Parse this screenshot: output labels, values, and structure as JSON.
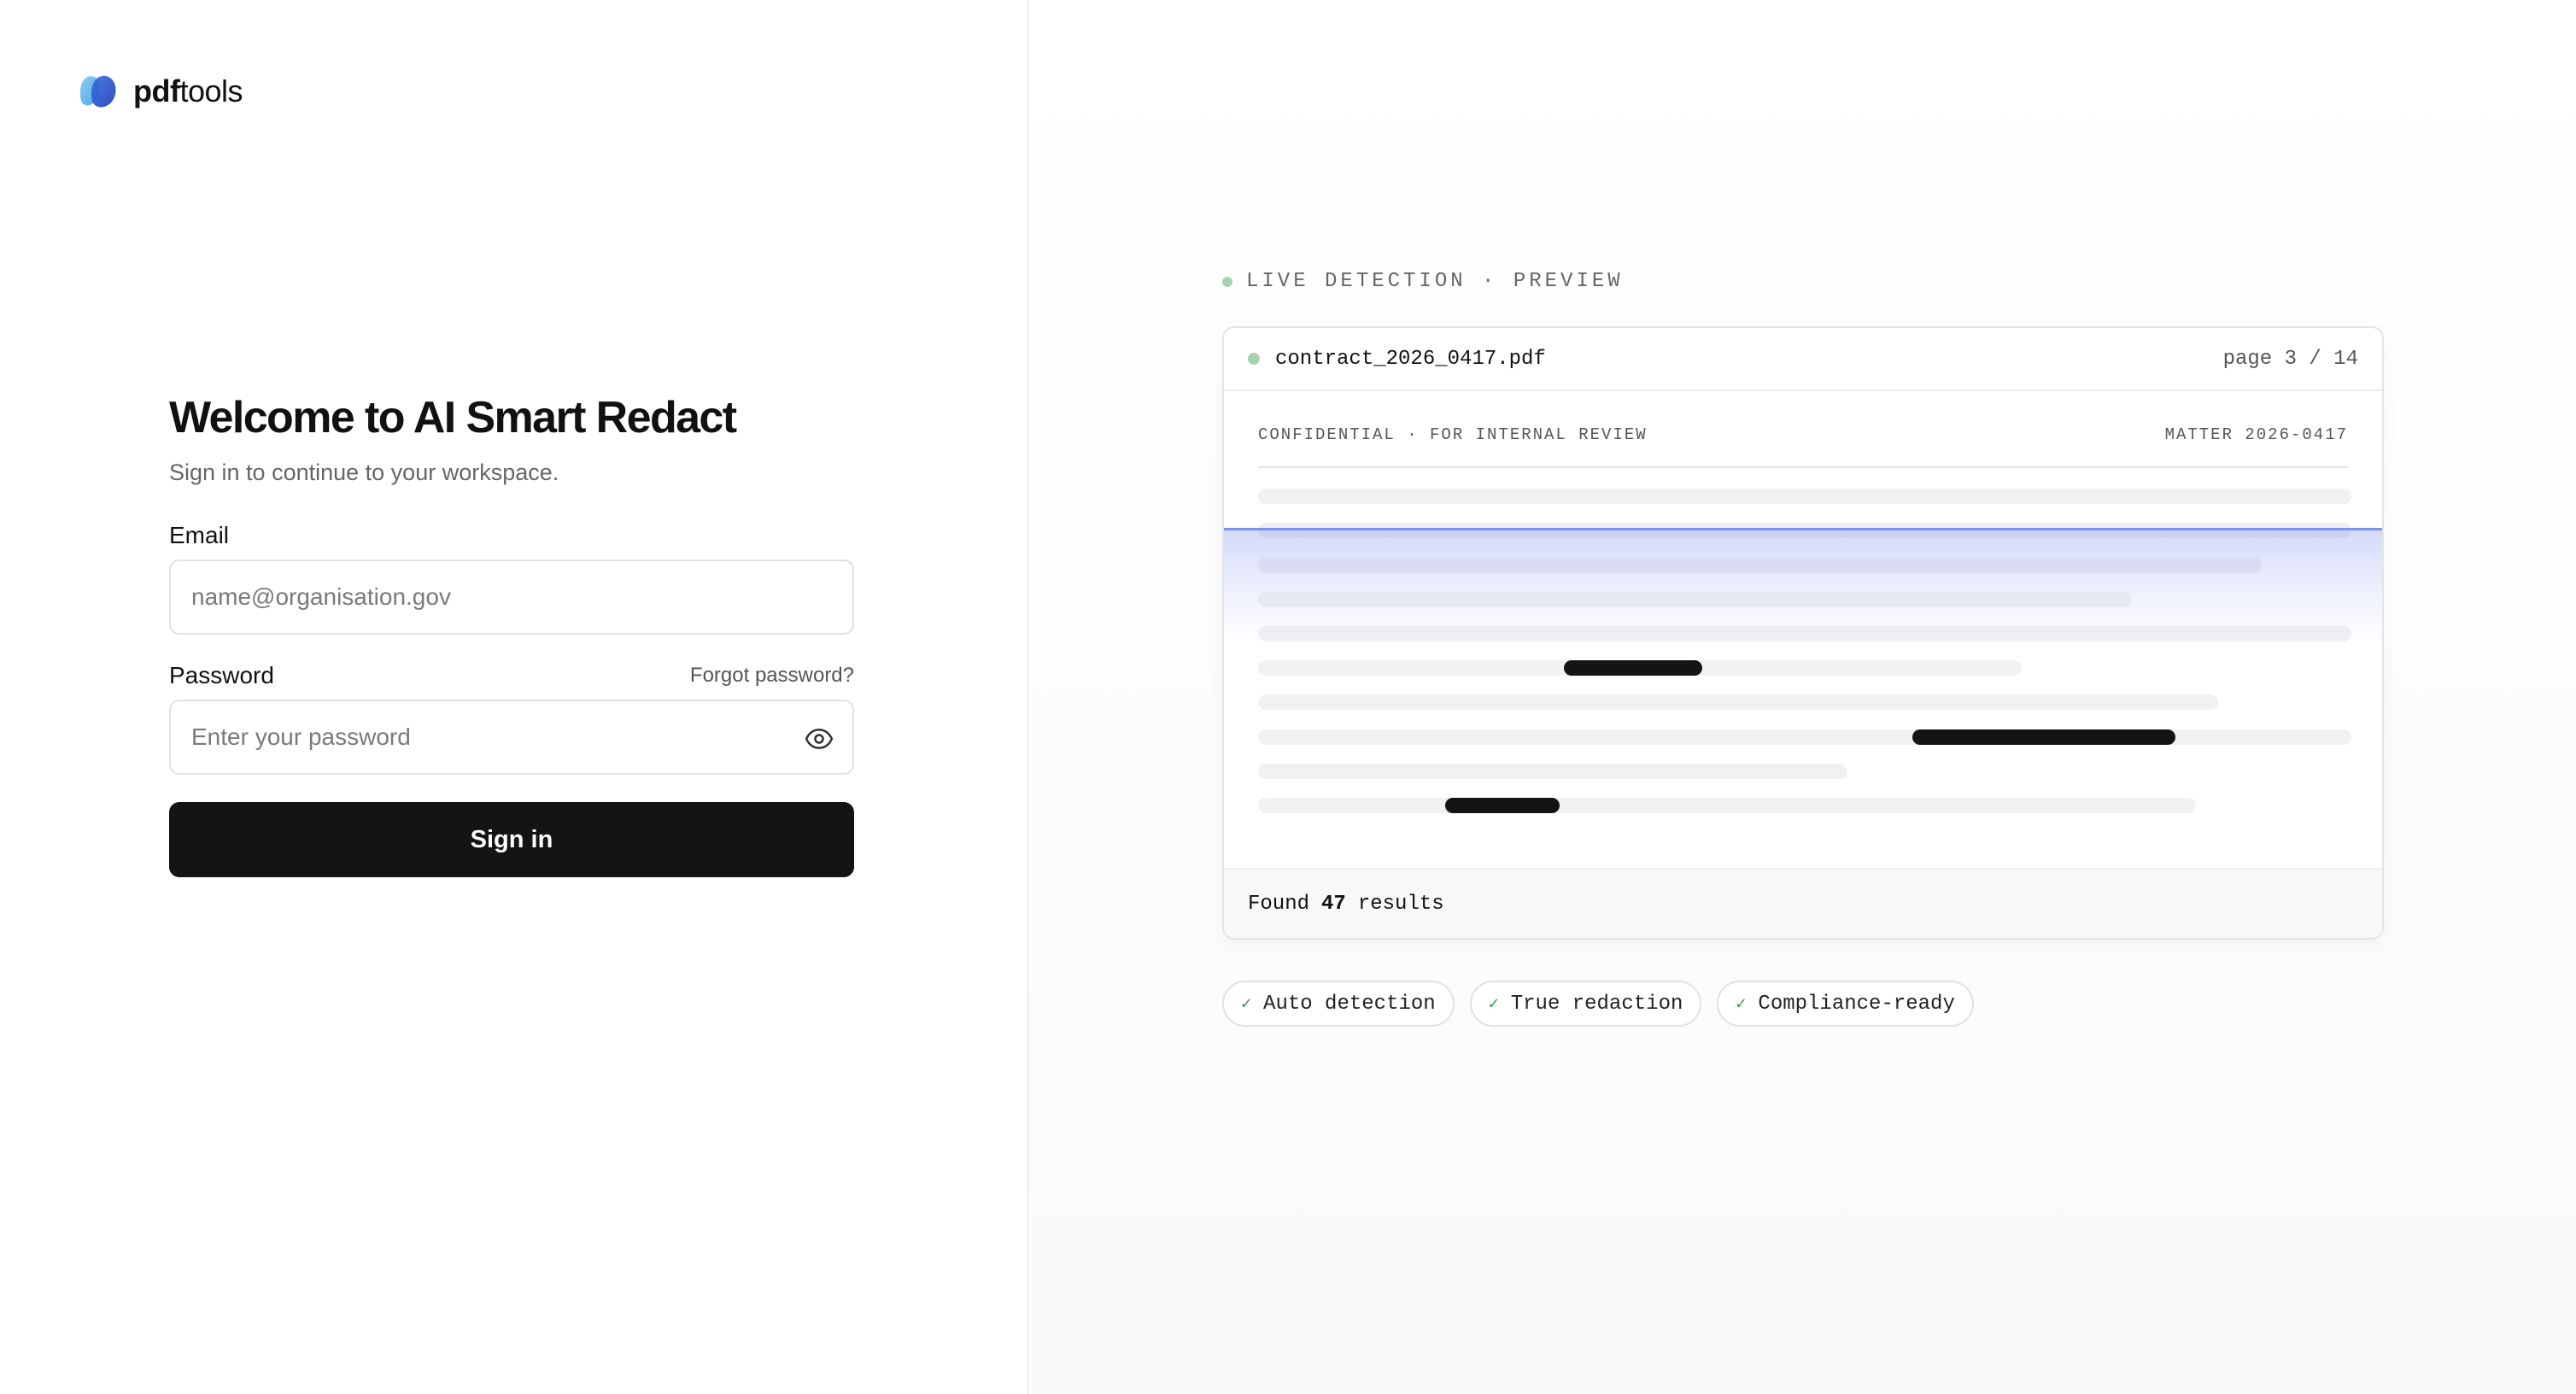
{
  "brand": {
    "name_bold": "pdf",
    "name_regular": "tools",
    "logo_icon": "pdftools-logo-icon"
  },
  "login": {
    "title": "Welcome to AI Smart Redact",
    "subtitle": "Sign in to continue to your workspace.",
    "email_label": "Email",
    "email_placeholder": "name@organisation.gov",
    "email_value": "",
    "password_label": "Password",
    "forgot_label": "Forgot password?",
    "password_placeholder": "Enter your password",
    "password_value": "",
    "password_toggle_icon": "eye-icon",
    "submit_label": "Sign in"
  },
  "preview": {
    "live_label": "LIVE DETECTION · PREVIEW",
    "file_name": "contract_2026_0417.pdf",
    "page_indicator": "page 3 / 14",
    "doc_header_left": "CONFIDENTIAL · FOR INTERNAL REVIEW",
    "doc_header_right": "MATTER 2026-0417",
    "found_prefix": "Found",
    "found_count": "47",
    "found_suffix": "results",
    "features": [
      {
        "check": "✓",
        "label": "Auto detection"
      },
      {
        "check": "✓",
        "label": "True redaction"
      },
      {
        "check": "✓",
        "label": "Compliance-ready"
      }
    ],
    "colors": {
      "status_dot": "#a8d3b0",
      "scan_line": "#7e92f0",
      "redaction": "#141414",
      "check": "#2f9a48"
    }
  }
}
